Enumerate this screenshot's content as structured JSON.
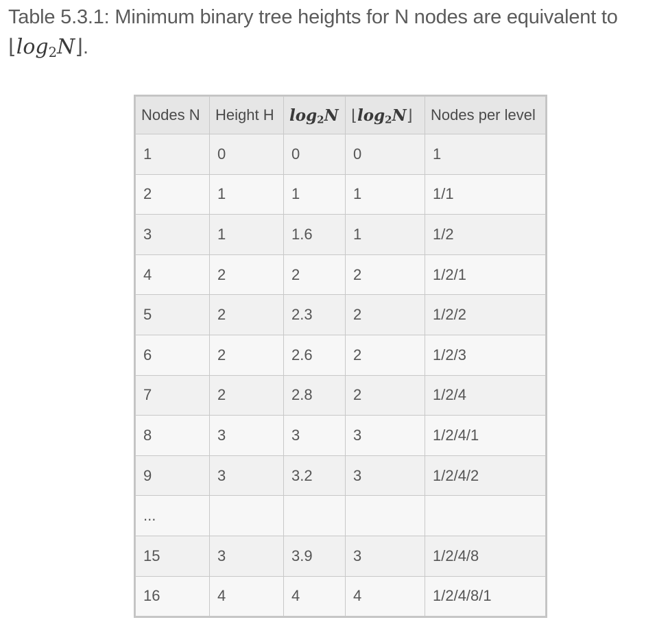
{
  "caption": {
    "prefix": "Table 5.3.1: Minimum binary tree heights for N nodes are equivalent to",
    "expr_floor_open": "⌊",
    "expr_log": "log",
    "expr_base": "2",
    "expr_var": "N",
    "expr_floor_close": "⌋",
    "suffix": "."
  },
  "table": {
    "headers": {
      "nodes": "Nodes N",
      "height": "Height H",
      "log_fn": "log",
      "log_base": "2",
      "log_var": "N",
      "floor_open": "⌊",
      "floor_fn": "log",
      "floor_base": "2",
      "floor_var": "N",
      "floor_close": "⌋",
      "per_level": "Nodes per level"
    },
    "rows": [
      {
        "n": "1",
        "h": "0",
        "log": "0",
        "floor": "0",
        "per_level": "1"
      },
      {
        "n": "2",
        "h": "1",
        "log": "1",
        "floor": "1",
        "per_level": "1/1"
      },
      {
        "n": "3",
        "h": "1",
        "log": "1.6",
        "floor": "1",
        "per_level": "1/2"
      },
      {
        "n": "4",
        "h": "2",
        "log": "2",
        "floor": "2",
        "per_level": "1/2/1"
      },
      {
        "n": "5",
        "h": "2",
        "log": "2.3",
        "floor": "2",
        "per_level": "1/2/2"
      },
      {
        "n": "6",
        "h": "2",
        "log": "2.6",
        "floor": "2",
        "per_level": "1/2/3"
      },
      {
        "n": "7",
        "h": "2",
        "log": "2.8",
        "floor": "2",
        "per_level": "1/2/4"
      },
      {
        "n": "8",
        "h": "3",
        "log": "3",
        "floor": "3",
        "per_level": "1/2/4/1"
      },
      {
        "n": "9",
        "h": "3",
        "log": "3.2",
        "floor": "3",
        "per_level": "1/2/4/2"
      },
      {
        "n": "...",
        "h": "",
        "log": "",
        "floor": "",
        "per_level": ""
      },
      {
        "n": "15",
        "h": "3",
        "log": "3.9",
        "floor": "3",
        "per_level": "1/2/4/8"
      },
      {
        "n": "16",
        "h": "4",
        "log": "4",
        "floor": "4",
        "per_level": "1/2/4/8/1"
      }
    ]
  }
}
